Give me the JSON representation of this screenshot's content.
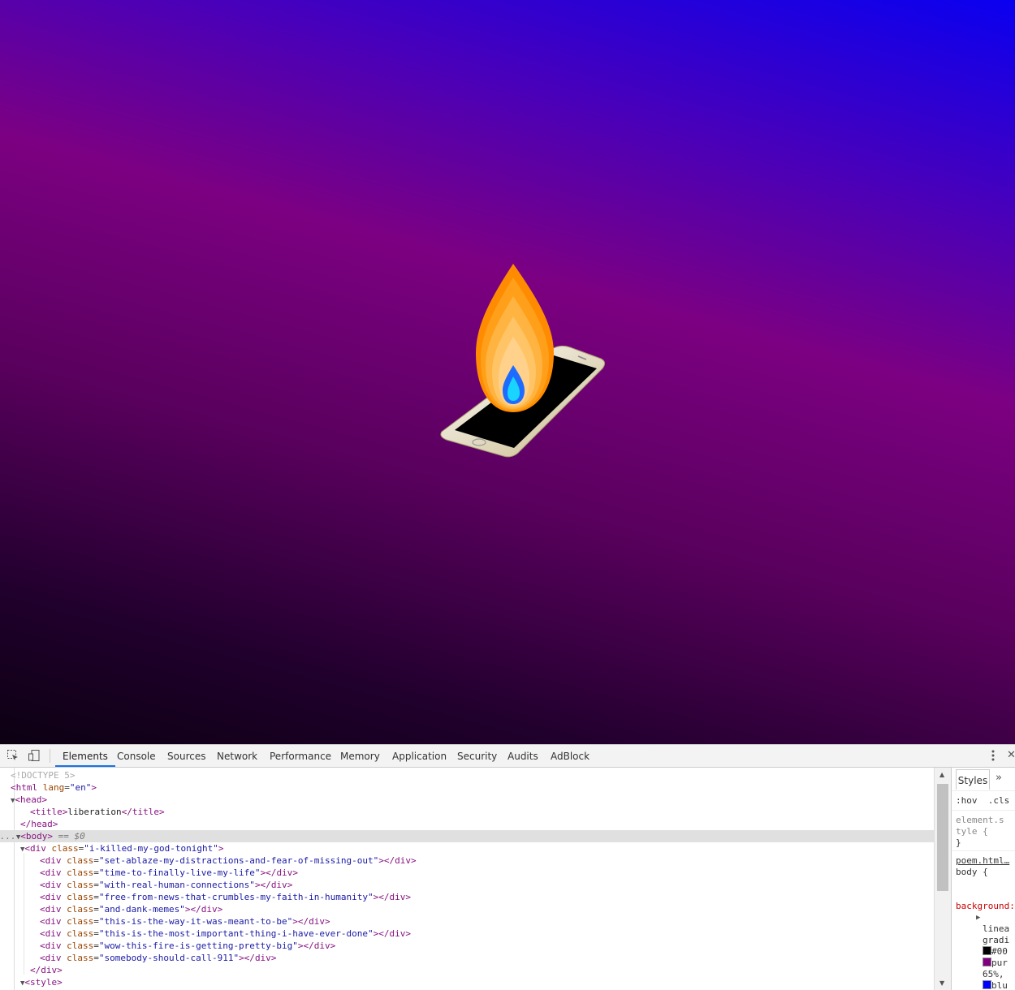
{
  "page": {
    "title": "liberation"
  },
  "colors": {
    "gradient_stop_1": "#000000",
    "gradient_stop_2": "purple",
    "gradient_stop_3": "blue",
    "flame_outer": "#ff8c00",
    "flame_core": "#1e90ff",
    "phone_body": "#ffffff",
    "phone_screen": "#000000",
    "devtools_active_tab": "#1a73e8"
  },
  "devtools": {
    "toolbar": {
      "inspect_icon": "inspect-element-icon",
      "device_icon": "device-toggle-icon",
      "menu_icon": "kebab-menu-icon",
      "close_icon": "close-icon",
      "tabs": [
        {
          "label": "Elements"
        },
        {
          "label": "Console"
        },
        {
          "label": "Sources"
        },
        {
          "label": "Network"
        },
        {
          "label": "Performance"
        },
        {
          "label": "Memory"
        },
        {
          "label": "Application"
        },
        {
          "label": "Security"
        },
        {
          "label": "Audits"
        },
        {
          "label": "AdBlock"
        }
      ],
      "active_tab": "Elements"
    },
    "dom": {
      "doctype": "<!DOCTYPE 5>",
      "html_open": "html",
      "html_attr": "lang",
      "html_val": "\"en\"",
      "head": "head",
      "title_tag": "title",
      "title_text": "liberation",
      "body": "body",
      "body_marker": " == $0",
      "body_dots": "...",
      "wrapper_class": "\"i-killed-my-god-tonight\"",
      "children": [
        "\"set-ablaze-my-distractions-and-fear-of-missing-out\"",
        "\"time-to-finally-live-my-life\"",
        "\"with-real-human-connections\"",
        "\"free-from-news-that-crumbles-my-faith-in-humanity\"",
        "\"and-dank-memes\"",
        "\"this-is-the-way-it-was-meant-to-be\"",
        "\"this-is-the-most-important-thing-i-have-ever-done\"",
        "\"wow-this-fire-is-getting-pretty-big\"",
        "\"somebody-should-call-911\""
      ],
      "div_tag": "div",
      "class_attr": "class",
      "style_tag": "style"
    },
    "styles_panel": {
      "tab_label": "Styles",
      "hov": ":hov",
      "cls": ".cls",
      "element_style_1": "element.s",
      "element_style_2": "tyle {",
      "close_brace": "}",
      "source": "poem.html…",
      "selector": "body {",
      "property": "background:",
      "value_1": "linea",
      "value_2": "gradi",
      "color_1": "#00",
      "color_2": "pur",
      "percent": "65%,",
      "color_3": "blu"
    }
  }
}
